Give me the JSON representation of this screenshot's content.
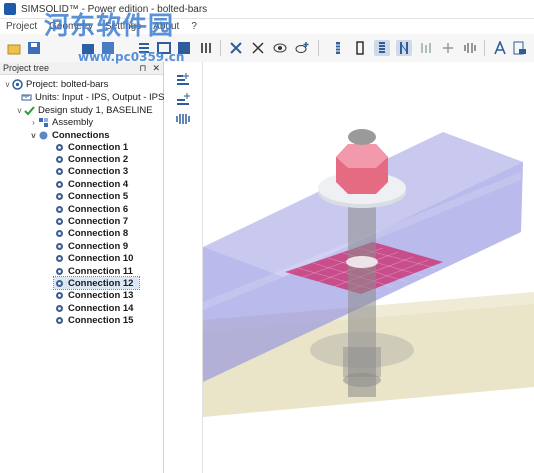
{
  "window": {
    "title": "SIMSOLID™ - Power edition - bolted-bars"
  },
  "watermark": {
    "text": "河东软件园",
    "url": "www.pc0359.cn"
  },
  "menu": {
    "items": [
      "Project",
      "Geometry",
      "Settings",
      "About",
      "?"
    ]
  },
  "toolbar": {
    "icons": [
      "open-icon",
      "save-icon",
      "undo-icon",
      "redo-icon",
      "layout-icon",
      "cut-icon",
      "cross-section-icon",
      "eye-icon",
      "eye-plus-icon",
      "bolt-icon",
      "nut-icon",
      "spring-icon",
      "fastener-icon",
      "separator-icon",
      "joint-icon",
      "wave-icon",
      "arrow-icon",
      "measure-icon",
      "text-icon",
      "scale-icon"
    ]
  },
  "panel": {
    "title": "Project tree",
    "pin_label": "⊓",
    "close_label": "✕"
  },
  "tree": {
    "project": "Project: bolted-bars",
    "units": "Units: Input - IPS, Output - IPS",
    "design_study": "Design study 1, BASELINE",
    "assembly": "Assembly",
    "connections": "Connections",
    "connection_items": [
      "Connection 1",
      "Connection 2",
      "Connection 3",
      "Connection 4",
      "Connection 5",
      "Connection 6",
      "Connection 7",
      "Connection 8",
      "Connection 9",
      "Connection 10",
      "Connection 11",
      "Connection 12",
      "Connection 13",
      "Connection 14",
      "Connection 15"
    ],
    "selected_index": 11
  },
  "colors": {
    "top_bar": "#8c8ce0",
    "bottom_bar": "#d8cf9a",
    "nut": "#e46b82",
    "washer": "#d9dde4",
    "bolt": "#8a8a8a",
    "weld": "#cc2a6b"
  }
}
